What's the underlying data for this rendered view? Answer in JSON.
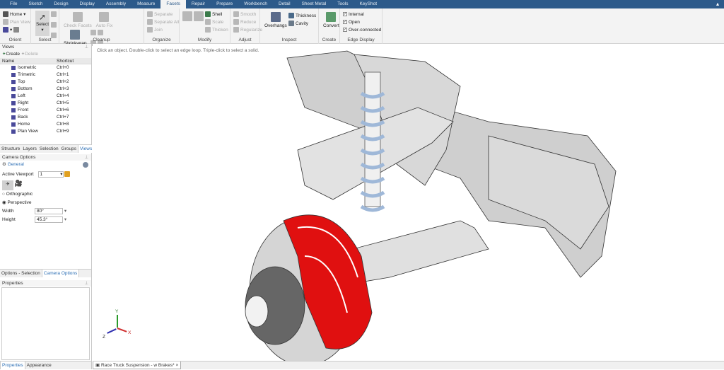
{
  "menu": [
    "File",
    "Sketch",
    "Design",
    "Display",
    "Assembly",
    "Measure",
    "Facets",
    "Repair",
    "Prepare",
    "Workbench",
    "Detail",
    "Sheet Metal",
    "Tools",
    "KeyShot"
  ],
  "active_menu": "Facets",
  "ribbon": {
    "orient": {
      "label": "Orient",
      "home": "Home",
      "plan_view": "Plan View"
    },
    "select": {
      "label": "Select",
      "button": "Select"
    },
    "cleanup": {
      "label": "Cleanup",
      "check_facets": "Check Facets",
      "auto_fix": "Auto Fix",
      "shrinkwrap": "Shrinkwrap"
    },
    "organize": {
      "label": "Organize",
      "separate": "Separate",
      "separate_all": "Separate All",
      "join": "Join"
    },
    "modify": {
      "label": "Modify",
      "shell": "Shell",
      "scale": "Scale",
      "thicken": "Thicken"
    },
    "adjust": {
      "label": "Adjust",
      "smooth": "Smooth",
      "reduce": "Reduce",
      "regularize": "Regularize"
    },
    "inspect": {
      "label": "Inspect",
      "overhangs": "Overhangs",
      "thickness": "Thickness",
      "cavity": "Cavity"
    },
    "create": {
      "label": "Create",
      "convert": "Convert"
    },
    "edge_display": {
      "label": "Edge Display",
      "options": [
        {
          "label": "Internal",
          "checked": true
        },
        {
          "label": "Open",
          "checked": true
        },
        {
          "label": "Over-connected",
          "checked": true
        }
      ]
    }
  },
  "views_panel": {
    "title": "Views",
    "create": "Create",
    "delete": "Delete",
    "col_name": "Name",
    "col_shortcut": "Shortcut",
    "items": [
      {
        "name": "Isometric",
        "shortcut": "Ctrl+0"
      },
      {
        "name": "Trimetric",
        "shortcut": "Ctrl+1"
      },
      {
        "name": "Top",
        "shortcut": "Ctrl+2"
      },
      {
        "name": "Bottom",
        "shortcut": "Ctrl+3"
      },
      {
        "name": "Left",
        "shortcut": "Ctrl+4"
      },
      {
        "name": "Right",
        "shortcut": "Ctrl+5"
      },
      {
        "name": "Front",
        "shortcut": "Ctrl+6"
      },
      {
        "name": "Back",
        "shortcut": "Ctrl+7"
      },
      {
        "name": "Home",
        "shortcut": "Ctrl+8"
      },
      {
        "name": "Plan View",
        "shortcut": "Ctrl+9"
      }
    ],
    "tabs": [
      "Structure",
      "Layers",
      "Selection",
      "Groups",
      "Views"
    ],
    "active_tab": "Views"
  },
  "camera_panel": {
    "title": "Camera Options",
    "section": "General",
    "active_viewport_label": "Active Viewport",
    "active_viewport": "1",
    "orthographic": "Orthographic",
    "perspective": "Perspective",
    "projection": "Perspective",
    "width_label": "Width",
    "width": "80°",
    "height_label": "Height",
    "height": "45.3°",
    "tabs": [
      "Options - Selection",
      "Camera Options"
    ],
    "active_tab": "Camera Options"
  },
  "properties_panel": {
    "title": "Properties",
    "tabs": [
      "Properties",
      "Appearance"
    ]
  },
  "viewport": {
    "hint": "Click an object. Double-click to select an edge loop. Triple-click to select a solid.",
    "axes": {
      "x": "X",
      "y": "Y",
      "z": "Z"
    }
  },
  "document_tab": "Race Truck Suspension - w Brakes*",
  "colors": {
    "menubar": "#2c5a8a",
    "caliper": "#e01010",
    "spring": "#9fb8d8",
    "chassis": "#c8c8c8"
  }
}
